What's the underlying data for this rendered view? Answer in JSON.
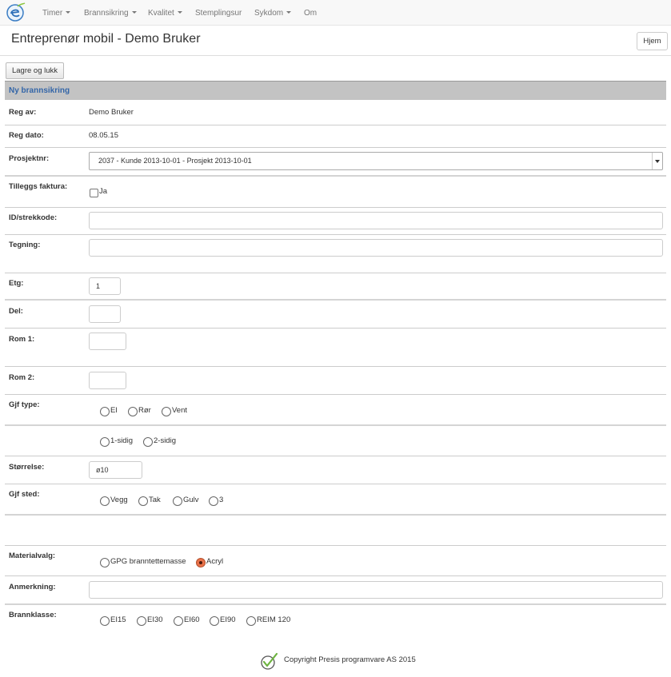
{
  "nav": {
    "items": [
      {
        "label": "Timer",
        "dropdown": true
      },
      {
        "label": "Brannsikring",
        "dropdown": true
      },
      {
        "label": "Kvalitet",
        "dropdown": true
      },
      {
        "label": "Stemplingsur",
        "dropdown": false
      },
      {
        "label": "Sykdom",
        "dropdown": true
      },
      {
        "label": "Om",
        "dropdown": false
      }
    ]
  },
  "header": {
    "title": "Entreprenør mobil - Demo Bruker",
    "home_label": "Hjem"
  },
  "toolbar": {
    "save_label": "Lagre og lukk"
  },
  "form": {
    "section_title": "Ny brannsikring",
    "reg_av": {
      "label": "Reg av:",
      "value": "Demo Bruker"
    },
    "reg_dato": {
      "label": "Reg dato:",
      "value": "08.05.15"
    },
    "prosjektnr": {
      "label": "Prosjektnr:",
      "value": "2037 - Kunde 2013-10-01 - Prosjekt 2013-10-01"
    },
    "tilleggs_faktura": {
      "label": "Tilleggs faktura:",
      "option": "Ja",
      "checked": false
    },
    "id_strekkode": {
      "label": "ID/strekkode:",
      "value": ""
    },
    "tegning": {
      "label": "Tegning:",
      "value": ""
    },
    "etg": {
      "label": "Etg:",
      "value": "1"
    },
    "del": {
      "label": "Del:",
      "value": ""
    },
    "rom1": {
      "label": "Rom 1:",
      "value": ""
    },
    "rom2": {
      "label": "Rom 2:",
      "value": ""
    },
    "gjf_type": {
      "label": "Gjf type:",
      "options": [
        "El",
        "Rør",
        "Vent"
      ],
      "selected": null
    },
    "sidig": {
      "options": [
        "1-sidig",
        "2-sidig"
      ],
      "selected": null
    },
    "storrelse": {
      "label": "Størrelse:",
      "value": "ø10"
    },
    "gjf_sted": {
      "label": "Gjf sted:",
      "options": [
        "Vegg",
        "Tak",
        "Gulv",
        "3"
      ],
      "selected": null
    },
    "materialvalg": {
      "label": "Materialvalg:",
      "options": [
        "GPG branntettemasse",
        "Acryl"
      ],
      "selected": "Acryl"
    },
    "anmerkning": {
      "label": "Anmerkning:",
      "value": ""
    },
    "brannklasse": {
      "label": "Brannklasse:",
      "options": [
        "EI15",
        "EI30",
        "EI60",
        "EI90",
        "REIM 120"
      ],
      "selected": null
    }
  },
  "footer": {
    "text": "Copyright Presis programvare AS 2015"
  },
  "colors": {
    "section_title": "#3466a8",
    "section_bg": "#c3c3c3",
    "radio_selected": "#e9724a"
  }
}
